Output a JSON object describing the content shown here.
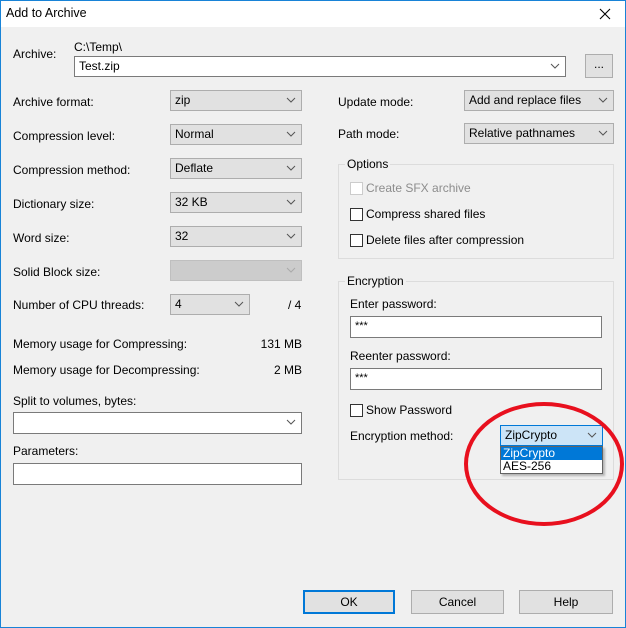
{
  "window": {
    "title": "Add to Archive",
    "close_icon": "close-icon"
  },
  "archive": {
    "label": "Archive:",
    "path": "C:\\Temp\\",
    "filename": "Test.zip",
    "browse_label": "..."
  },
  "left": {
    "archive_format": {
      "label": "Archive format:",
      "value": "zip"
    },
    "compression_level": {
      "label": "Compression level:",
      "value": "Normal"
    },
    "compression_method": {
      "label": "Compression method:",
      "value": "Deflate"
    },
    "dictionary_size": {
      "label": "Dictionary size:",
      "value": "32 KB"
    },
    "word_size": {
      "label": "Word size:",
      "value": "32"
    },
    "solid_block_size": {
      "label": "Solid Block size:",
      "value": ""
    },
    "cpu_threads": {
      "label": "Number of CPU threads:",
      "value": "4",
      "max": "/ 4"
    },
    "memory_compress": {
      "label": "Memory usage for Compressing:",
      "value": "131 MB"
    },
    "memory_decompress": {
      "label": "Memory usage for Decompressing:",
      "value": "2 MB"
    },
    "split_volumes": {
      "label": "Split to volumes, bytes:",
      "value": ""
    },
    "parameters": {
      "label": "Parameters:",
      "value": ""
    }
  },
  "right": {
    "update_mode": {
      "label": "Update mode:",
      "value": "Add and replace files"
    },
    "path_mode": {
      "label": "Path mode:",
      "value": "Relative pathnames"
    },
    "options": {
      "title": "Options",
      "items": [
        {
          "label": "Create SFX archive",
          "checked": false,
          "disabled": true
        },
        {
          "label": "Compress shared files",
          "checked": false,
          "disabled": false
        },
        {
          "label": "Delete files after compression",
          "checked": false,
          "disabled": false
        }
      ]
    },
    "encryption": {
      "title": "Encryption",
      "enter_password_label": "Enter password:",
      "enter_password_value": "***",
      "reenter_password_label": "Reenter password:",
      "reenter_password_value": "***",
      "show_password_label": "Show Password",
      "show_password_checked": false,
      "method_label": "Encryption method:",
      "method_value": "ZipCrypto",
      "method_options": [
        "ZipCrypto",
        "AES-256"
      ],
      "method_selected_index": 0
    }
  },
  "buttons": {
    "ok": "OK",
    "cancel": "Cancel",
    "help": "Help"
  },
  "annotation": {
    "type": "red-ellipse-highlight",
    "color": "#e8101e"
  }
}
